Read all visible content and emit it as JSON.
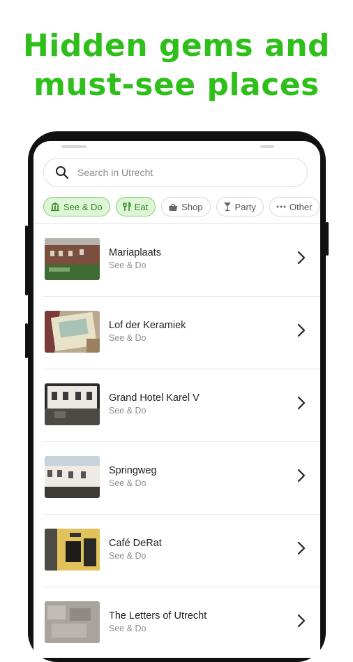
{
  "headline": {
    "line1": "Hidden gems and",
    "line2": "must-see places"
  },
  "search": {
    "placeholder": "Search in Utrecht",
    "icon": "search-icon"
  },
  "chips": [
    {
      "label": "See & Do",
      "icon": "museum-icon",
      "active": true
    },
    {
      "label": "Eat",
      "icon": "fork-knife-icon",
      "active": true
    },
    {
      "label": "Shop",
      "icon": "shopping-bag-icon",
      "active": false
    },
    {
      "label": "Party",
      "icon": "cocktail-icon",
      "active": false
    },
    {
      "label": "Other",
      "icon": "more-dots-icon",
      "active": false
    }
  ],
  "places": [
    {
      "title": "Mariaplaats",
      "category": "See & Do"
    },
    {
      "title": "Lof der Keramiek",
      "category": "See & Do"
    },
    {
      "title": "Grand Hotel Karel V",
      "category": "See & Do"
    },
    {
      "title": "Springweg",
      "category": "See & Do"
    },
    {
      "title": "Café DeRat",
      "category": "See & Do"
    },
    {
      "title": "The Letters of Utrecht",
      "category": "See & Do"
    }
  ],
  "colors": {
    "accent": "#2fbf1a",
    "chip_active_bg": "#dff5d8",
    "chip_active_border": "#7ed36a"
  }
}
